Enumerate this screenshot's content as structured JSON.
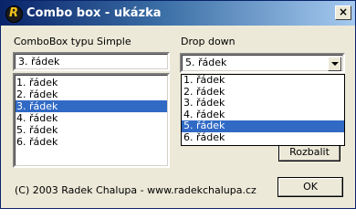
{
  "window": {
    "title": "Combo box - ukázka",
    "close_glyph": "×"
  },
  "simple": {
    "label": "ComboBox typu Simple",
    "value": "3. řádek",
    "items": [
      "1. řádek",
      "2. řádek",
      "3. řádek",
      "4. řádek",
      "5. řádek",
      "6. řádek"
    ],
    "selected_index": 2
  },
  "dropdown": {
    "label": "Drop down",
    "value": "5. řádek",
    "items": [
      "1. řádek",
      "2. řádek",
      "3. řádek",
      "4. řádek",
      "5. řádek",
      "6. řádek"
    ],
    "selected_index": 4,
    "expand_button": "Rozbalit"
  },
  "footer": {
    "text": "(C) 2003 Radek Chalupa - www.radekchalupa.cz"
  },
  "ok_button": "OK"
}
